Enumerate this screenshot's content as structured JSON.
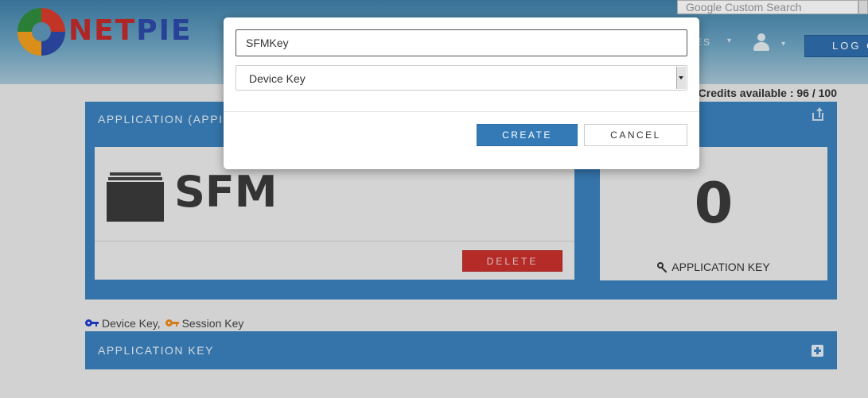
{
  "header": {
    "logo_text_a": "NET",
    "logo_text_b": "PIE",
    "logo_sub": "",
    "search_placeholder": "Google Custom Search",
    "nav_partial": "ES",
    "logout_label": "LOG OUT"
  },
  "credits": "Credits available : 96 / 100",
  "application": {
    "panel_title": "APPLICATION (APPID",
    "app_name": "SFM",
    "delete_label": "DELETE",
    "key_count": "0",
    "key_label": "APPLICATION KEY"
  },
  "legend": {
    "device_key": "Device Key,",
    "session_key": "Session Key",
    "device_key_color": "#1f3fcf",
    "session_key_color": "#f0891e"
  },
  "appkey_panel": {
    "title": "APPLICATION KEY"
  },
  "modal": {
    "name_value": "SFMKey",
    "type_selected": "Device Key",
    "create_label": "CREATE",
    "cancel_label": "CANCEL"
  },
  "colors": {
    "primary": "#337ab7",
    "panel": "#3a82be",
    "danger": "#c9302c"
  },
  "icons": {
    "logo": "netpie-gear-logo",
    "user": "user-icon",
    "share": "share-icon",
    "folder": "folder-icon",
    "key": "key-icon",
    "expand": "plus-square-icon",
    "select": "chevron-down-icon"
  }
}
